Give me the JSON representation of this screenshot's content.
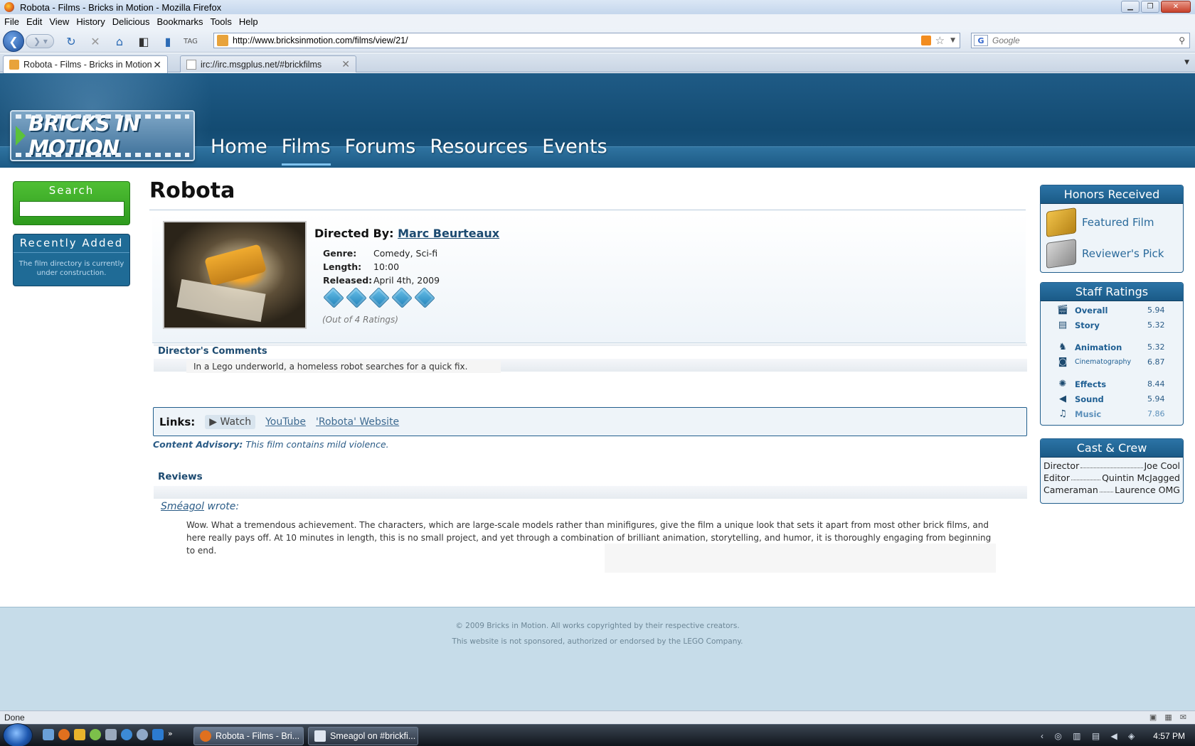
{
  "browser": {
    "window_title": "Robota - Films - Bricks in Motion - Mozilla Firefox",
    "menu": [
      "File",
      "Edit",
      "View",
      "History",
      "Delicious",
      "Bookmarks",
      "Tools",
      "Help"
    ],
    "url": "http://www.bricksinmotion.com/films/view/21/",
    "search_placeholder": "Google",
    "tabs": [
      {
        "label": "Robota - Films - Bricks in Motion",
        "active": true
      },
      {
        "label": "irc://irc.msgplus.net/#brickfilms",
        "active": false
      }
    ],
    "status": "Done"
  },
  "site": {
    "logo_text": "BRICKS IN MOTION",
    "nav": [
      "Home",
      "Films",
      "Forums",
      "Resources",
      "Events"
    ],
    "current_nav": "Films",
    "search_label": "Search",
    "recently_added_label": "Recently Added",
    "recently_added_body": "The film directory is currently under construction.",
    "footer": [
      "© 2009 Bricks in Motion. All works copyrighted by their respective creators.",
      "This website is not sponsored, authorized or endorsed by the LEGO Company."
    ]
  },
  "film": {
    "title": "Robota",
    "directed_by_label": "Directed By:",
    "director": "Marc Beurteaux",
    "facts": [
      {
        "key": "Genre:",
        "value": "Comedy, Sci-fi"
      },
      {
        "key": "Length:",
        "value": "10:00"
      },
      {
        "key": "Released:",
        "value": "April 4th, 2009"
      }
    ],
    "rating_bricks": 5,
    "ratings_note": "(Out of 4 Ratings)",
    "comments_heading": "Director's Comments",
    "comment": "In a Lego underworld, a homeless robot searches for a quick fix.",
    "links_label": "Links:",
    "links": {
      "watch": "Watch",
      "youtube": "YouTube",
      "website": "'Robota' Website"
    },
    "advisory_label": "Content Advisory:",
    "advisory_text": "This film contains mild violence.",
    "reviews_heading": "Reviews",
    "review": {
      "author": "Sméagol",
      "wrote": "wrote:",
      "text": "Wow.  What a tremendous achievement.  The characters, which are large-scale models rather than minifigures, give the film a unique look that sets it apart from most other brick films, and here really pays off.  At 10 minutes in length, this is no small project, and yet through a combination of brilliant animation, storytelling, and humor, it is thoroughly engaging from beginning to end."
    }
  },
  "honors": {
    "heading": "Honors Received",
    "items": [
      {
        "label": "Featured Film",
        "icon": "gold-brick-icon"
      },
      {
        "label": "Reviewer's Pick",
        "icon": "silver-brick-icon"
      }
    ]
  },
  "staff_ratings": {
    "heading": "Staff Ratings",
    "items": [
      {
        "name": "Overall",
        "value": "5.94",
        "icon": "clapperboard-icon"
      },
      {
        "name": "Story",
        "value": "5.32",
        "icon": "script-icon"
      },
      {
        "name": "Animation",
        "value": "5.32",
        "icon": "figure-icon"
      },
      {
        "name": "Cinematography",
        "value": "6.87",
        "icon": "camera-icon"
      },
      {
        "name": "Effects",
        "value": "8.44",
        "icon": "sparkle-icon"
      },
      {
        "name": "Sound",
        "value": "5.94",
        "icon": "speaker-icon"
      },
      {
        "name": "Music",
        "value": "7.86",
        "icon": "music-note-icon"
      }
    ]
  },
  "cast_crew": {
    "heading": "Cast & Crew",
    "items": [
      {
        "role": "Director",
        "who": "Joe Cool"
      },
      {
        "role": "Editor",
        "who": "Quintin McJagged"
      },
      {
        "role": "Cameraman",
        "who": "Laurence OMG"
      }
    ]
  },
  "taskbar": {
    "buttons": [
      "Robota - Films - Bri...",
      "Smeagol on #brickfi..."
    ],
    "clock": "4:57 PM"
  }
}
